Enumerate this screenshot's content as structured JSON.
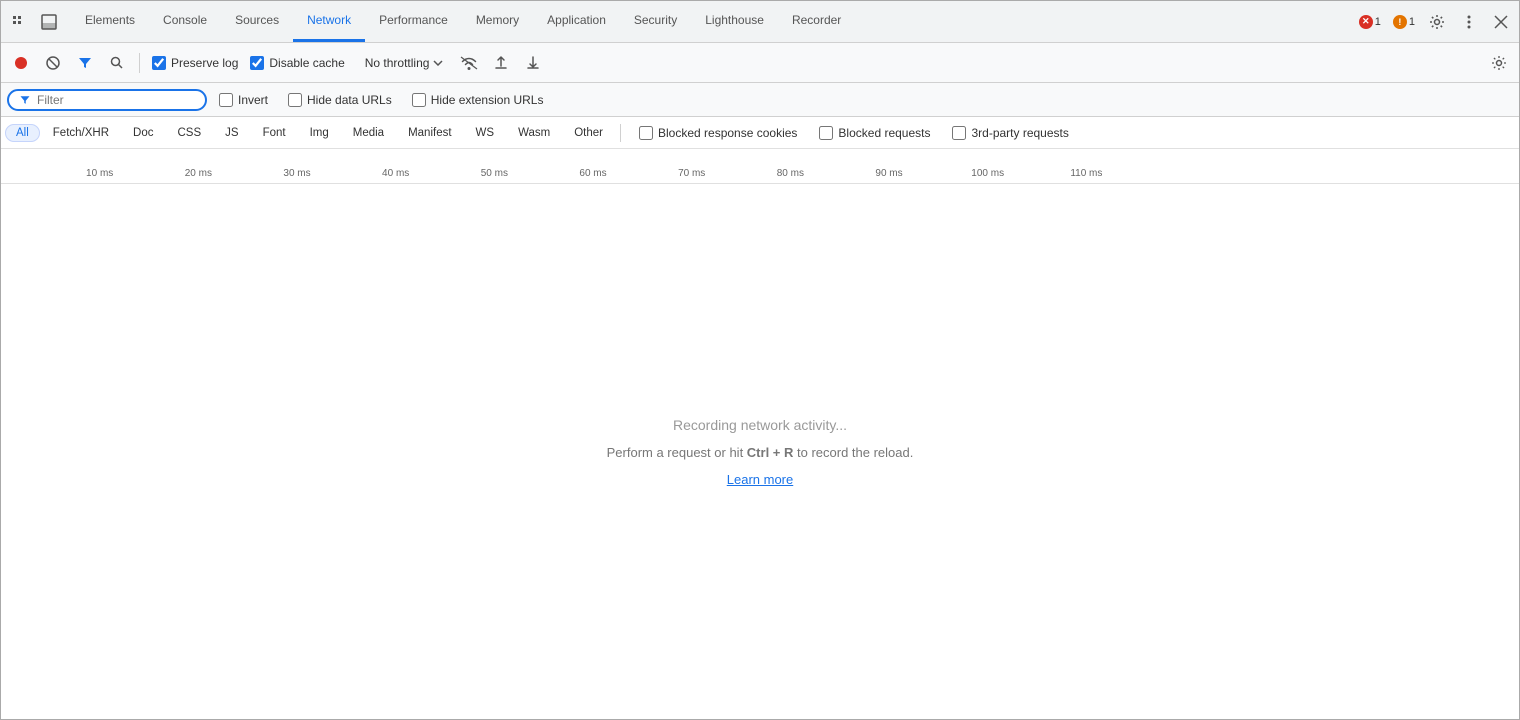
{
  "tabs": [
    {
      "id": "elements",
      "label": "Elements",
      "active": false
    },
    {
      "id": "console",
      "label": "Console",
      "active": false
    },
    {
      "id": "sources",
      "label": "Sources",
      "active": false
    },
    {
      "id": "network",
      "label": "Network",
      "active": true
    },
    {
      "id": "performance",
      "label": "Performance",
      "active": false
    },
    {
      "id": "memory",
      "label": "Memory",
      "active": false
    },
    {
      "id": "application",
      "label": "Application",
      "active": false
    },
    {
      "id": "security",
      "label": "Security",
      "active": false
    },
    {
      "id": "lighthouse",
      "label": "Lighthouse",
      "active": false
    },
    {
      "id": "recorder",
      "label": "Recorder",
      "active": false
    }
  ],
  "badges": {
    "error": {
      "count": "1",
      "color": "red"
    },
    "warning": {
      "count": "1",
      "color": "orange"
    }
  },
  "toolbar": {
    "preserve_log_label": "Preserve log",
    "disable_cache_label": "Disable cache",
    "throttle_label": "No throttling",
    "preserve_log_checked": true,
    "disable_cache_checked": true
  },
  "filter": {
    "placeholder": "Filter",
    "invert_label": "Invert",
    "hide_data_urls_label": "Hide data URLs",
    "hide_extension_urls_label": "Hide extension URLs"
  },
  "type_filters": [
    {
      "id": "all",
      "label": "All",
      "active": true
    },
    {
      "id": "fetch-xhr",
      "label": "Fetch/XHR",
      "active": false
    },
    {
      "id": "doc",
      "label": "Doc",
      "active": false
    },
    {
      "id": "css",
      "label": "CSS",
      "active": false
    },
    {
      "id": "js",
      "label": "JS",
      "active": false
    },
    {
      "id": "font",
      "label": "Font",
      "active": false
    },
    {
      "id": "img",
      "label": "Img",
      "active": false
    },
    {
      "id": "media",
      "label": "Media",
      "active": false
    },
    {
      "id": "manifest",
      "label": "Manifest",
      "active": false
    },
    {
      "id": "ws",
      "label": "WS",
      "active": false
    },
    {
      "id": "wasm",
      "label": "Wasm",
      "active": false
    },
    {
      "id": "other",
      "label": "Other",
      "active": false
    }
  ],
  "extra_checkboxes": [
    {
      "id": "blocked-cookies",
      "label": "Blocked response cookies"
    },
    {
      "id": "blocked-requests",
      "label": "Blocked requests"
    },
    {
      "id": "3rd-party",
      "label": "3rd-party requests"
    }
  ],
  "timeline": {
    "markers": [
      {
        "value": "10 ms",
        "percent": 6.5
      },
      {
        "value": "20 ms",
        "percent": 13
      },
      {
        "value": "30 ms",
        "percent": 19.5
      },
      {
        "value": "40 ms",
        "percent": 26
      },
      {
        "value": "50 ms",
        "percent": 32.5
      },
      {
        "value": "60 ms",
        "percent": 39
      },
      {
        "value": "70 ms",
        "percent": 45.5
      },
      {
        "value": "80 ms",
        "percent": 52
      },
      {
        "value": "90 ms",
        "percent": 58.5
      },
      {
        "value": "100 ms",
        "percent": 65
      },
      {
        "value": "110 ms",
        "percent": 71.5
      }
    ]
  },
  "empty_state": {
    "title": "Recording network activity...",
    "subtitle_pre": "Perform a request or hit ",
    "shortcut": "Ctrl + R",
    "subtitle_post": " to record the reload.",
    "learn_more": "Learn more"
  }
}
